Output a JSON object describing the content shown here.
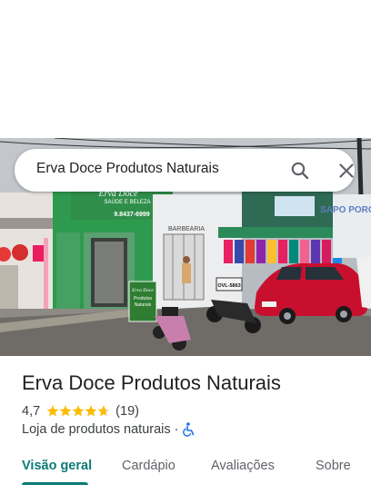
{
  "search": {
    "query": "Erva Doce Produtos Naturais",
    "search_icon": "search-icon",
    "close_icon": "close-icon"
  },
  "photo": {
    "store_sign_name": "Erva Doce",
    "store_sign_sub": "SAÚDE E BELEZA",
    "store_sign_phone": "9.8437-6999",
    "neighbor_sign": "BARBEARIA",
    "right_sign": "SAPO PORQU",
    "door_sign_brand": "Erva Doce",
    "door_sign_line1": "Produtos",
    "door_sign_line2": "Naturais",
    "moto_plate": "OVL-5863"
  },
  "place": {
    "name": "Erva Doce Produtos Naturais",
    "rating": "4,7",
    "stars": 4.7,
    "review_count": "(19)",
    "category": "Loja de produtos naturais",
    "separator": "·",
    "accessibility_icon": "wheelchair-icon"
  },
  "tabs": {
    "items": [
      {
        "label": "Visão geral"
      },
      {
        "label": "Cardápio"
      },
      {
        "label": "Avaliações"
      },
      {
        "label": "Sobre"
      }
    ],
    "active": 0
  },
  "colors": {
    "accent": "#0b7a75",
    "star": "#fbbc04",
    "store_green": "#2e9a4e"
  }
}
